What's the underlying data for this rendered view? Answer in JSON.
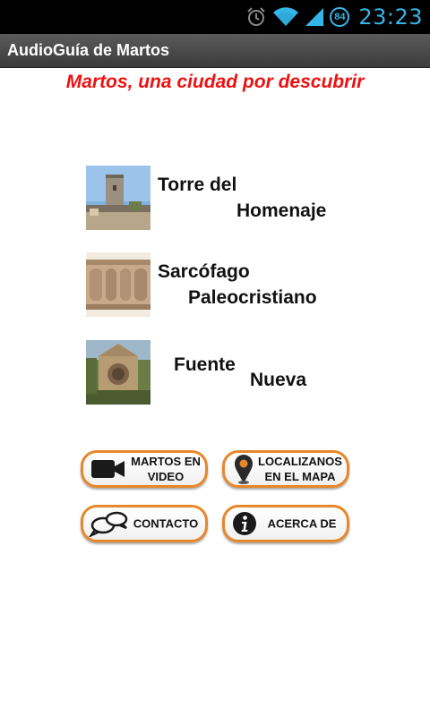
{
  "status_bar": {
    "battery_level": "84",
    "time": "23:23",
    "icons": [
      "alarm-icon",
      "wifi-icon",
      "signal-icon",
      "battery-icon"
    ]
  },
  "app": {
    "title": "AudioGuía de Martos"
  },
  "headline": "Martos, una ciudad por descubrir",
  "monuments": [
    {
      "line1": "Torre del",
      "line2": "Homenaje"
    },
    {
      "line1": "Sarcófago",
      "line2": "Paleocristiano"
    },
    {
      "line1": "Fuente",
      "line2": "Nueva"
    }
  ],
  "buttons": {
    "video": {
      "line1": "MARTOS EN",
      "line2": "VIDEO",
      "icon": "video-camera-icon"
    },
    "map": {
      "line1": "LOCALIZANOS",
      "line2": "EN EL MAPA",
      "icon": "map-pin-icon"
    },
    "contact": {
      "label": "CONTACTO",
      "icon": "speech-bubbles-icon"
    },
    "about": {
      "label": "ACERCA DE",
      "icon": "info-icon"
    }
  },
  "colors": {
    "accent_blue": "#33b5e5",
    "headline_red": "#ee1111",
    "button_border": "#e8872a"
  }
}
